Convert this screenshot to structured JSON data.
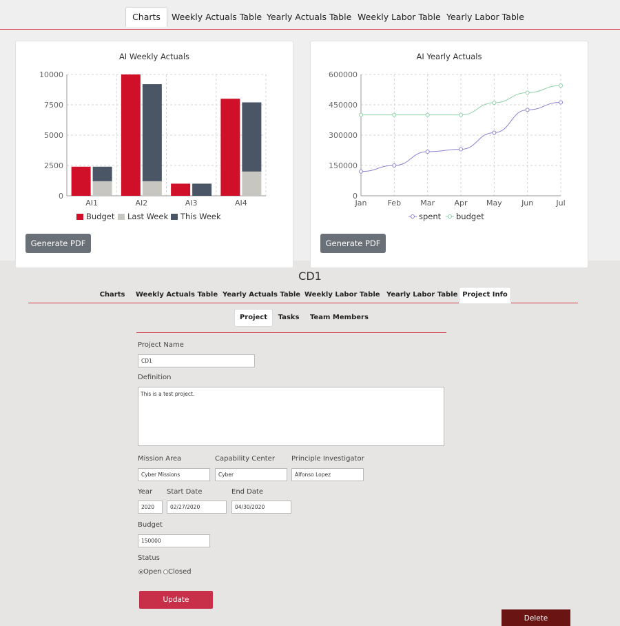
{
  "top_tabs": [
    "Charts",
    "Weekly Actuals Table",
    "Yearly Actuals Table",
    "Weekly Labor Table",
    "Yearly Labor Table"
  ],
  "generate_pdf_label": "Generate PDF",
  "colors": {
    "budget": "#cf1028",
    "last_week": "#c8c6c0",
    "this_week": "#4a5566",
    "spent": "#8a82d0",
    "line_budget": "#8fd0a8",
    "accent": "#d23c46"
  },
  "chart_data": [
    {
      "type": "bar",
      "title": "AI Weekly Actuals",
      "categories": [
        "AI1",
        "AI2",
        "AI3",
        "AI4"
      ],
      "series": [
        {
          "name": "Budget",
          "values": [
            2400,
            10000,
            1000,
            8000
          ]
        },
        {
          "name": "Last Week",
          "values": [
            1200,
            1200,
            0,
            2000
          ],
          "stack": "actual"
        },
        {
          "name": "This Week",
          "values": [
            1200,
            8000,
            1000,
            5700
          ],
          "stack": "actual"
        }
      ],
      "yticks": [
        "10000",
        "7500",
        "5000",
        "2500",
        "0"
      ],
      "ylim": [
        0,
        10000
      ],
      "grid": true,
      "legend": "bottom"
    },
    {
      "type": "line",
      "title": "AI Yearly Actuals",
      "x": [
        "Jan",
        "Feb",
        "Mar",
        "Apr",
        "May",
        "Jun",
        "Jul"
      ],
      "series": [
        {
          "name": "spent",
          "values": [
            120000,
            150000,
            218000,
            230000,
            312000,
            425000,
            462000
          ]
        },
        {
          "name": "budget",
          "values": [
            400000,
            400000,
            400000,
            400000,
            460000,
            510000,
            545000
          ]
        }
      ],
      "yticks": [
        "600000",
        "450000",
        "300000",
        "150000",
        "0"
      ],
      "ylim": [
        0,
        600000
      ],
      "grid": true,
      "legend": "bottom"
    }
  ],
  "project": {
    "title": "CD1",
    "tabs": [
      "Charts",
      "Weekly Actuals Table",
      "Yearly Actuals Table",
      "Weekly Labor Table",
      "Yearly Labor Table",
      "Project Info"
    ],
    "subtabs": [
      "Project",
      "Tasks",
      "Team Members"
    ],
    "form": {
      "project_name_label": "Project Name",
      "project_name_value": "CD1",
      "definition_label": "Definition",
      "definition_value": "This is a test project.",
      "mission_area_label": "Mission Area",
      "mission_area_value": "Cyber Missions",
      "capability_center_label": "Capability Center",
      "capability_center_value": "Cyber",
      "pi_label": "Principle Investigator",
      "pi_value": "Alfonso Lopez",
      "year_label": "Year",
      "year_value": "2020",
      "start_date_label": "Start Date",
      "start_date_value": "02/27/2020",
      "end_date_label": "End Date",
      "end_date_value": "04/30/2020",
      "budget_label": "Budget",
      "budget_value": "150000",
      "status_label": "Status",
      "status_open": "Open",
      "status_closed": "Closed",
      "status_selected": "Open",
      "update_label": "Update",
      "delete_label": "Delete"
    }
  }
}
